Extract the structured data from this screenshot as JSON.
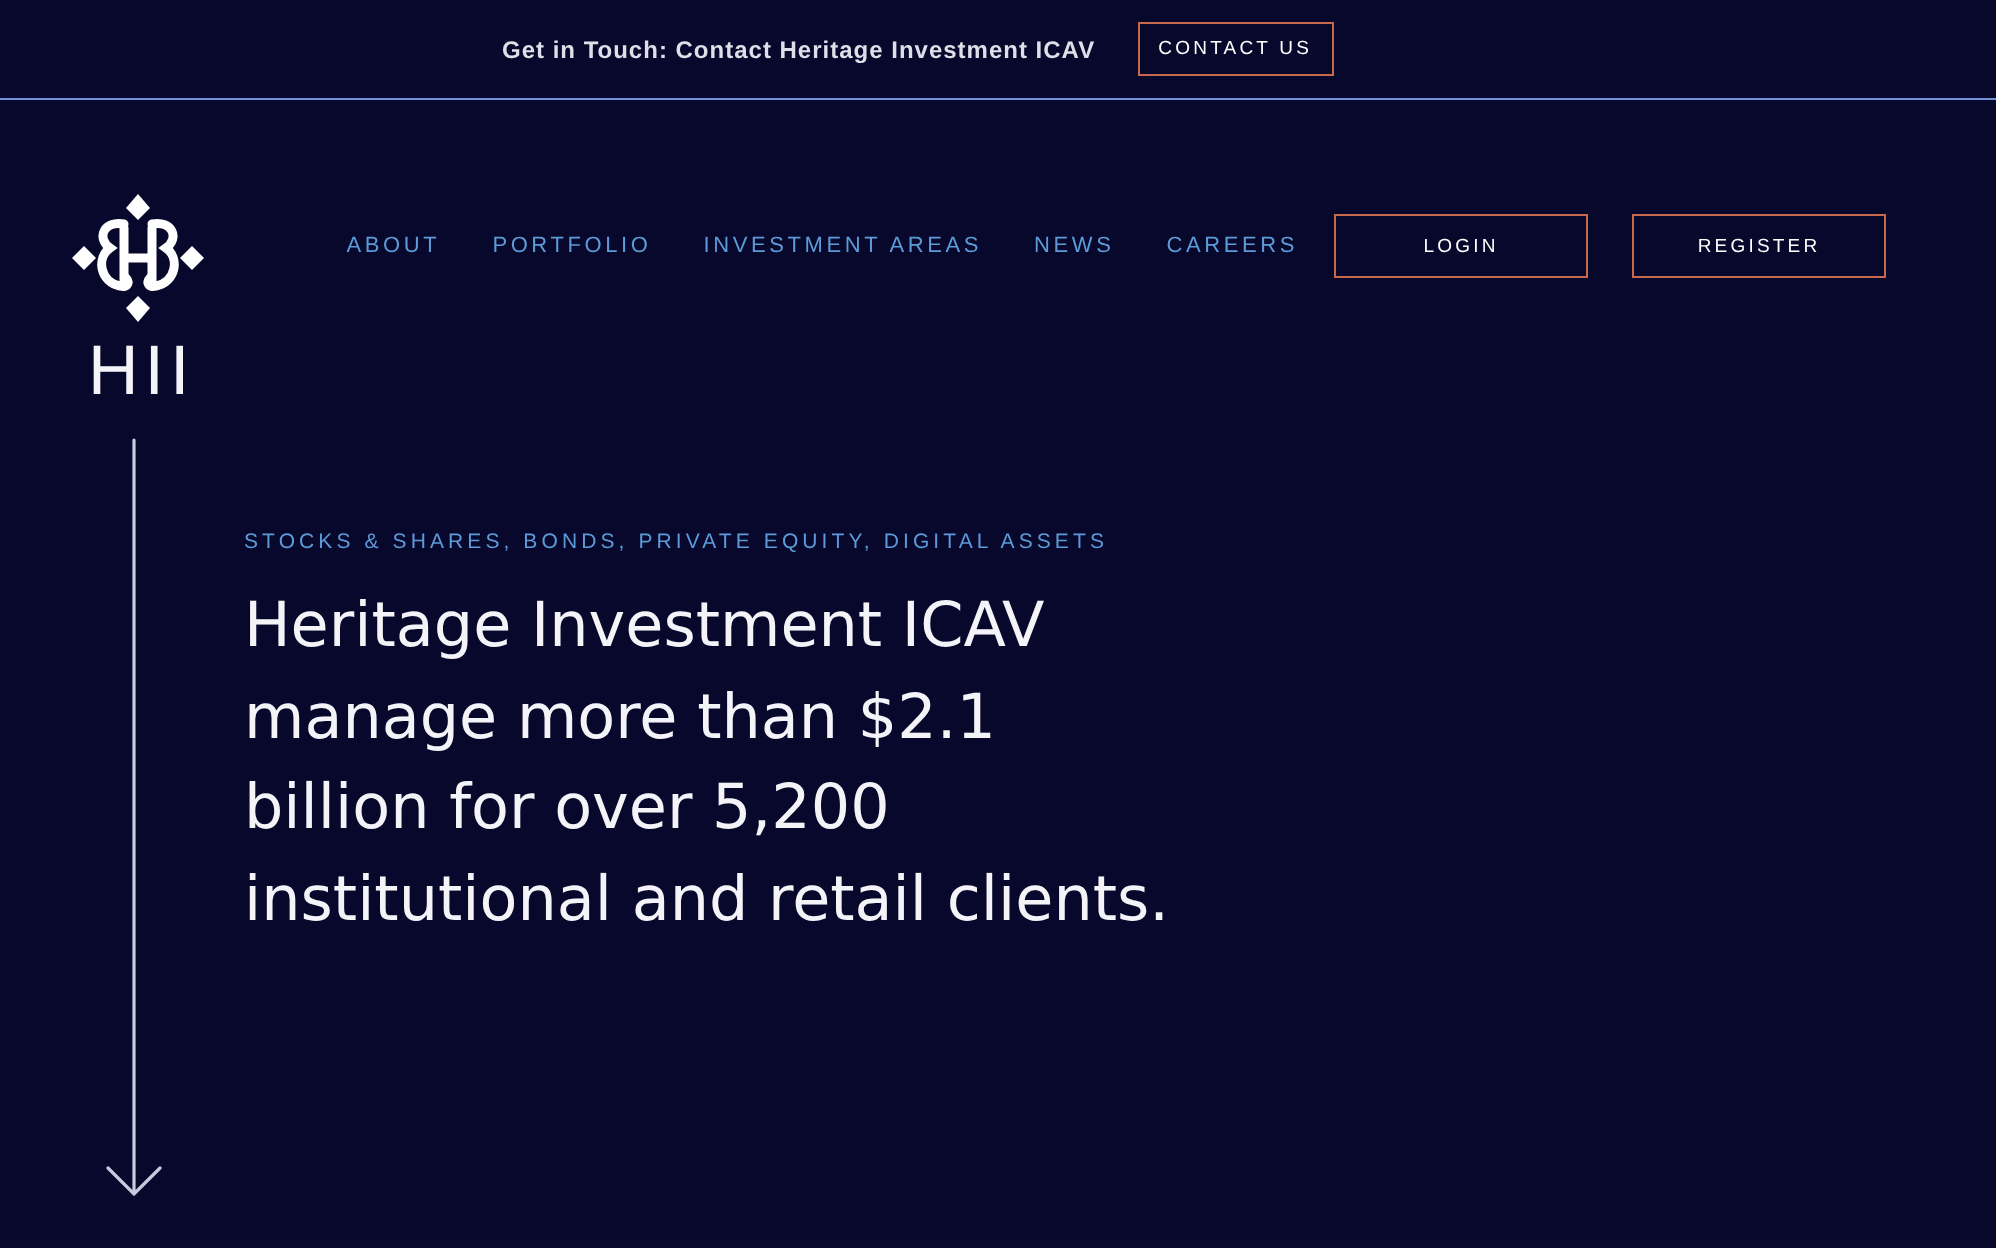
{
  "top_bar": {
    "text": "Get in Touch: Contact Heritage Investment ICAV",
    "button": "CONTACT US"
  },
  "logo": {
    "text": "HII"
  },
  "nav": {
    "links": [
      "ABOUT",
      "PORTFOLIO",
      "INVESTMENT AREAS",
      "NEWS",
      "CAREERS"
    ],
    "buttons": [
      "LOGIN",
      "REGISTER"
    ]
  },
  "hero": {
    "kicker": "STOCKS & SHARES, BONDS, PRIVATE EQUITY, DIGITAL ASSETS",
    "headline": "Heritage Investment ICAV manage more than $2.1 billion for over 5,200 institutional and retail clients."
  }
}
